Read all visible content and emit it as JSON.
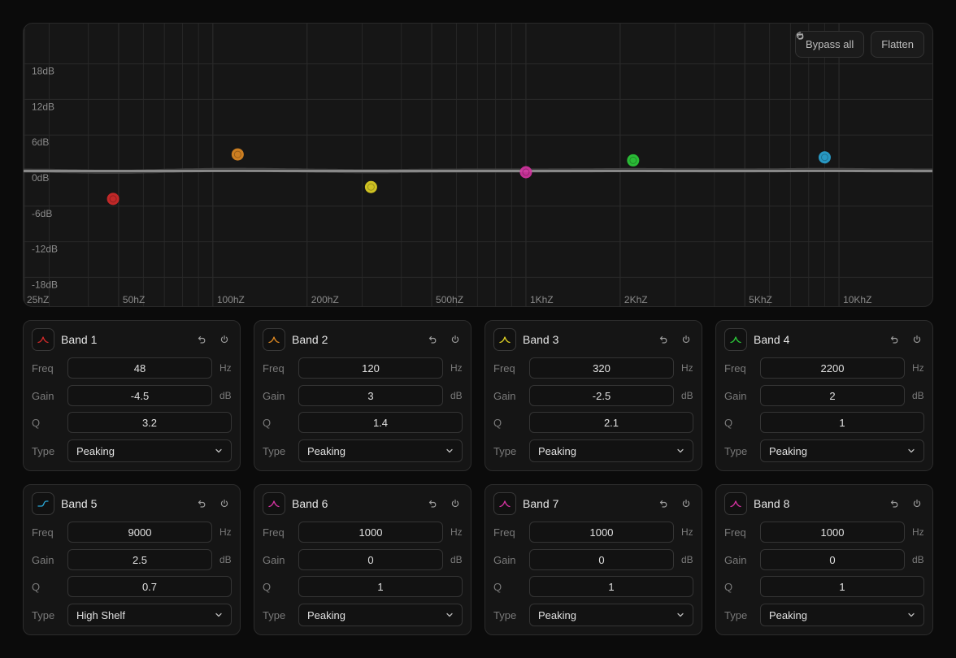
{
  "graph": {
    "buttons": {
      "bypass_label": "Bypass all",
      "flatten_label": "Flatten"
    },
    "db_ticks": [
      {
        "value": 18,
        "label": "18dB"
      },
      {
        "value": 12,
        "label": "12dB"
      },
      {
        "value": 6,
        "label": "6dB"
      },
      {
        "value": 0,
        "label": "0dB"
      },
      {
        "value": -6,
        "label": "-6dB"
      },
      {
        "value": -12,
        "label": "-12dB"
      },
      {
        "value": -18,
        "label": "-18dB"
      }
    ],
    "freq_ticks": [
      {
        "value": 25,
        "label": "25hZ"
      },
      {
        "value": 50,
        "label": "50hZ"
      },
      {
        "value": 100,
        "label": "100hZ"
      },
      {
        "value": 200,
        "label": "200hZ"
      },
      {
        "value": 500,
        "label": "500hZ"
      },
      {
        "value": 1000,
        "label": "1KhZ"
      },
      {
        "value": 2000,
        "label": "2KhZ"
      },
      {
        "value": 5000,
        "label": "5KhZ"
      },
      {
        "value": 10000,
        "label": "10KhZ"
      }
    ],
    "minor_gridlines_hz": [
      30,
      40,
      60,
      70,
      80,
      90,
      300,
      400,
      600,
      700,
      800,
      900,
      3000,
      4000,
      6000,
      7000,
      8000,
      9000,
      20000
    ],
    "freq_range": [
      25,
      20000
    ],
    "db_range": [
      -24,
      24
    ]
  },
  "labels": {
    "freq": "Freq",
    "gain": "Gain",
    "q": "Q",
    "type": "Type",
    "hz": "Hz",
    "db": "dB"
  },
  "bands": [
    {
      "name": "Band 1",
      "freq": "48",
      "gain": "-4.5",
      "q": "3.2",
      "type": "Peaking",
      "color": "#d42a2a",
      "icon": "peak-icon"
    },
    {
      "name": "Band 2",
      "freq": "120",
      "gain": "3",
      "q": "1.4",
      "type": "Peaking",
      "color": "#e08a22",
      "icon": "peak-icon"
    },
    {
      "name": "Band 3",
      "freq": "320",
      "gain": "-2.5",
      "q": "2.1",
      "type": "Peaking",
      "color": "#e2d424",
      "icon": "peak-icon"
    },
    {
      "name": "Band 4",
      "freq": "2200",
      "gain": "2",
      "q": "1",
      "type": "Peaking",
      "color": "#2ccc3a",
      "icon": "peak-icon"
    },
    {
      "name": "Band 5",
      "freq": "9000",
      "gain": "2.5",
      "q": "0.7",
      "type": "High Shelf",
      "color": "#2aa6d6",
      "icon": "high-shelf-icon"
    },
    {
      "name": "Band 6",
      "freq": "1000",
      "gain": "0",
      "q": "1",
      "type": "Peaking",
      "color": "#d633a2",
      "icon": "peak-icon"
    },
    {
      "name": "Band 7",
      "freq": "1000",
      "gain": "0",
      "q": "1",
      "type": "Peaking",
      "color": "#d633a2",
      "icon": "peak-icon"
    },
    {
      "name": "Band 8",
      "freq": "1000",
      "gain": "0",
      "q": "1",
      "type": "Peaking",
      "color": "#d633a2",
      "icon": "peak-icon"
    }
  ],
  "handles": [
    {
      "freq": 48,
      "gain": -4.5,
      "color": "#d42a2a"
    },
    {
      "freq": 120,
      "gain": 3,
      "color": "#e08a22"
    },
    {
      "freq": 320,
      "gain": -2.5,
      "color": "#e2d424"
    },
    {
      "freq": 1000,
      "gain": 0,
      "color": "#d633a2"
    },
    {
      "freq": 2200,
      "gain": 2,
      "color": "#2ccc3a"
    },
    {
      "freq": 9000,
      "gain": 2.5,
      "color": "#2aa6d6"
    }
  ]
}
